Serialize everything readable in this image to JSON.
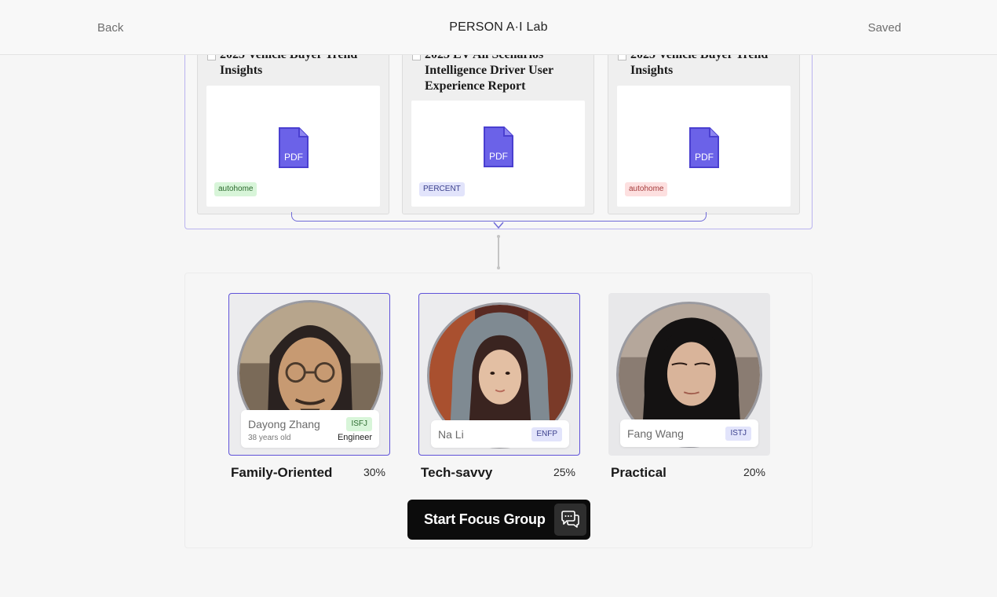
{
  "header": {
    "back_label": "Back",
    "title": "PERSON A·I Lab",
    "status": "Saved"
  },
  "reports": [
    {
      "title": "2025 Vehicle Buyer Trend Insights",
      "file_type": "PDF",
      "source": "autohome",
      "tag_color": "#d8f5d9"
    },
    {
      "title": "2025 EV All Scenarios Intelligence Driver User Experience Report",
      "file_type": "PDF",
      "source": "PERCENT",
      "tag_color": "#e2e4fb"
    },
    {
      "title": "2025 Vehicle Buyer Trend Insights",
      "file_type": "PDF",
      "source": "autohome",
      "tag_color": "#fde0e0"
    }
  ],
  "personas": [
    {
      "name": "Dayong Zhang",
      "age": "38 years old",
      "role": "Engineer",
      "mbti": "ISFJ",
      "segment": "Family-Oriented",
      "share": "30%",
      "selected": true
    },
    {
      "name": "Na Li",
      "mbti": "ENFP",
      "segment": "Tech-savvy",
      "share": "25%",
      "selected": true
    },
    {
      "name": "Fang Wang",
      "mbti": "ISTJ",
      "segment": "Practical",
      "share": "20%",
      "selected": false
    }
  ],
  "actions": {
    "start_label": "Start Focus Group",
    "chat_icon": "chat-bubbles-icon"
  },
  "colors": {
    "accent": "#5f52d9",
    "pdf_icon": "#6b62e8",
    "button_bg": "#0c0c0c"
  }
}
